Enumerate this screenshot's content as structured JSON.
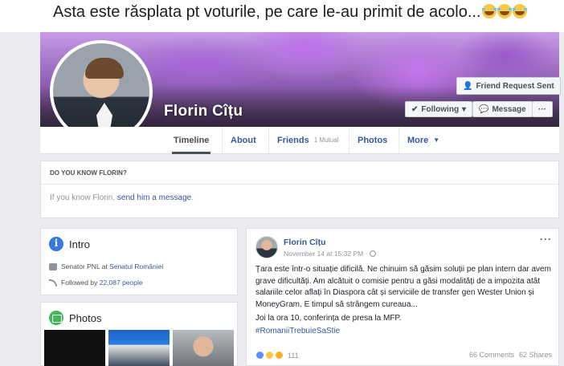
{
  "caption": {
    "text": "Asta este răsplata pt voturile, pe care le-au primit de acolo..."
  },
  "profile": {
    "name": "Florin Cîțu",
    "friend_request_label": "Friend Request Sent",
    "following_label": "Following",
    "message_label": "Message",
    "more_label": "···"
  },
  "tabs": {
    "timeline": "Timeline",
    "about": "About",
    "friends": "Friends",
    "friends_mutual": "1 Mutual",
    "photos": "Photos",
    "more": "More",
    "more_caret": "▼"
  },
  "know": {
    "title": "DO YOU KNOW FLORIN?",
    "text_prefix": "If you know Florin, ",
    "link": "send him a message",
    "text_suffix": "."
  },
  "intro": {
    "title": "Intro",
    "position": "Senator PNL at ",
    "employer": "Senatul României",
    "followed_prefix": "Followed by ",
    "followers": "22,087 people"
  },
  "photos": {
    "title": "Photos"
  },
  "post": {
    "author": "Florin Cîțu",
    "time": "November 14 at 15:32 PM · ",
    "menu": "···",
    "body": "Țara este într-o situație dificilă. Ne chinuim să găsim soluții pe plan intern dar avem grave dificultăți. Am alcătuit o comisie pentru a găsi modalități de a impozita atât salariile celor aflați în Diaspora cât și serviciile de transfer gen Wester Union și MoneyGram. E timpul să strângem cureaua...",
    "line2": "Joi la ora 10, conferința de presa la MFP.",
    "hashtag": "#RomaniiTrebuieSaStie",
    "reaction_count": "111",
    "comments": "66 Comments",
    "shares": "62 Shares"
  },
  "colors": {
    "link": "#365899",
    "page_bg": "#e9ebee",
    "cover_purple": "#a662dc"
  },
  "icons": [
    "friend-request-icon",
    "check-icon",
    "messenger-icon",
    "info-icon",
    "photos-icon",
    "briefcase-icon",
    "followers-icon",
    "globe-icon",
    "like-icon",
    "wow-icon",
    "sad-icon",
    "laughing-emoji-icon"
  ]
}
